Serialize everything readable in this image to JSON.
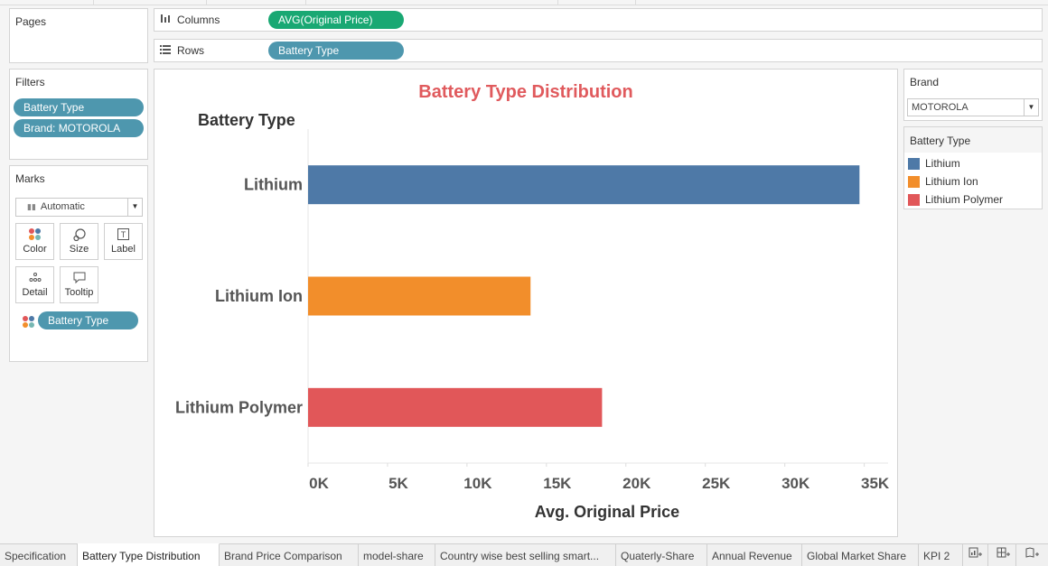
{
  "pages_panel": {
    "title": "Pages"
  },
  "shelves": {
    "columns": {
      "label": "Columns",
      "pill": "AVG(Original Price)"
    },
    "rows": {
      "label": "Rows",
      "pill": "Battery Type"
    }
  },
  "filters": {
    "title": "Filters",
    "items": [
      "Battery Type",
      "Brand: MOTOROLA"
    ]
  },
  "marks": {
    "title": "Marks",
    "type": "Automatic",
    "buttons": {
      "color": "Color",
      "size": "Size",
      "label": "Label",
      "detail": "Detail",
      "tooltip": "Tooltip"
    },
    "fields": [
      "Battery Type"
    ]
  },
  "brand_filter": {
    "title": "Brand",
    "selected": "MOTOROLA"
  },
  "legend": {
    "title": "Battery Type",
    "items": [
      {
        "label": "Lithium",
        "color": "#4e79a7"
      },
      {
        "label": "Lithium Ion",
        "color": "#f28e2b"
      },
      {
        "label": "Lithium Polymer",
        "color": "#e15759"
      }
    ]
  },
  "chart_data": {
    "type": "bar",
    "orientation": "horizontal",
    "title": "Battery Type Distribution",
    "row_header": "Battery Type",
    "xlabel": "Avg. Original Price",
    "categories": [
      "Lithium",
      "Lithium Ion",
      "Lithium Polymer"
    ],
    "values": [
      34700,
      14000,
      18500
    ],
    "colors": [
      "#4e79a7",
      "#f28e2b",
      "#e15759"
    ],
    "xlim": [
      0,
      36500
    ],
    "xticks": [
      0,
      5000,
      10000,
      15000,
      20000,
      25000,
      30000,
      35000
    ],
    "xtick_labels": [
      "0K",
      "5K",
      "10K",
      "15K",
      "20K",
      "25K",
      "30K",
      "35K"
    ],
    "grid": false,
    "legend": "right"
  },
  "tabs": {
    "sheets": [
      "Specification",
      "Battery Type Distribution",
      "Brand Price Comparison",
      "model-share",
      "Country wise best selling smart...",
      "Quaterly-Share",
      "Annual Revenue",
      "Global Market Share",
      "KPI 2"
    ],
    "active": "Battery Type Distribution",
    "icons": [
      "new-worksheet-icon",
      "new-dashboard-icon",
      "new-story-icon"
    ]
  }
}
